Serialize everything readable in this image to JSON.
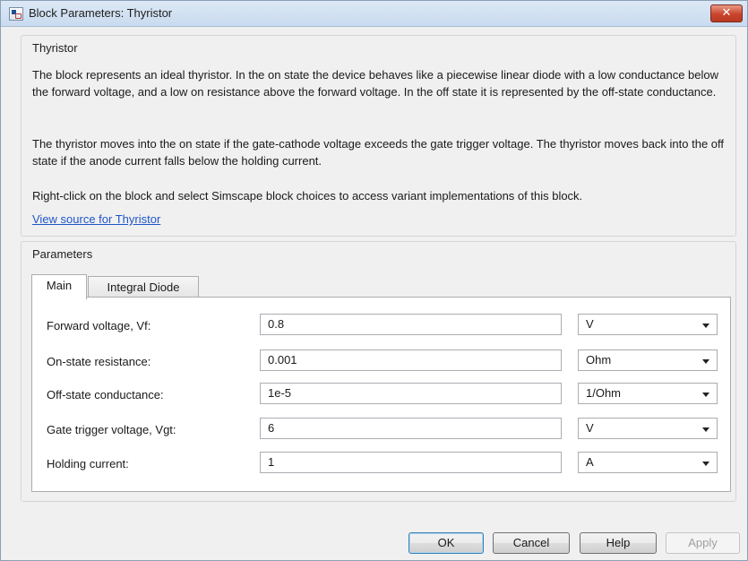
{
  "window": {
    "title": "Block Parameters: Thyristor",
    "close_glyph": "✕"
  },
  "description": {
    "group_label": "Thyristor",
    "para1": "The block represents an ideal thyristor. In the on state the device behaves like a piecewise linear diode with a low conductance below the forward voltage, and a low on resistance above the forward voltage. In the off state it is represented by the off-state conductance.",
    "para2": "The thyristor moves into the on state if the gate-cathode voltage exceeds the gate trigger voltage. The thyristor moves back into the off state if the anode current falls below the holding current.",
    "para3": "Right-click on the block and select Simscape block choices to access variant implementations of this block.",
    "link": "View source for Thyristor"
  },
  "parameters": {
    "group_label": "Parameters",
    "tabs": [
      {
        "label": "Main",
        "active": true
      },
      {
        "label": "Integral Diode",
        "active": false
      }
    ],
    "rows": [
      {
        "label": "Forward voltage, Vf:",
        "value": "0.8",
        "unit": "V"
      },
      {
        "label": "On-state resistance:",
        "value": "0.001",
        "unit": "Ohm"
      },
      {
        "label": "Off-state conductance:",
        "value": "1e-5",
        "unit": "1/Ohm"
      },
      {
        "label": "Gate trigger voltage, Vgt:",
        "value": "6",
        "unit": "V"
      },
      {
        "label": "Holding current:",
        "value": "1",
        "unit": "A"
      }
    ]
  },
  "buttons": {
    "ok": "OK",
    "cancel": "Cancel",
    "help": "Help",
    "apply": "Apply"
  },
  "icons": {
    "app": "simulink-block-icon",
    "close": "close-icon",
    "dropdown": "chevron-down-icon"
  }
}
